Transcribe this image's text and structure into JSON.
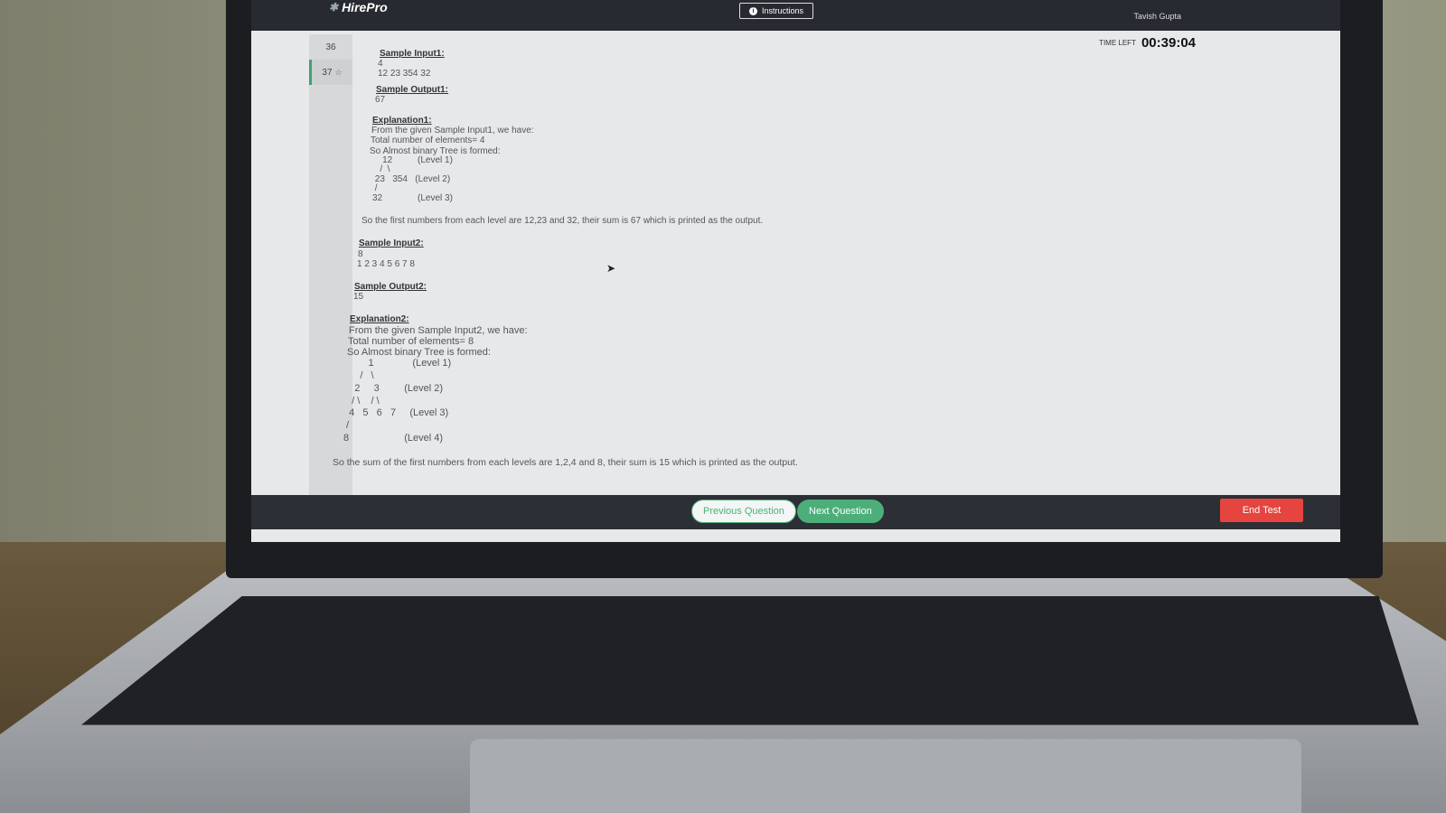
{
  "app": {
    "logo": "HirePro",
    "instructions_label": "Instructions",
    "user_name": "Tavish Gupta",
    "timer_label": "TIME LEFT",
    "timer_value": "00:39:04"
  },
  "question_nav": {
    "items": [
      {
        "number": "36",
        "starred": false,
        "active": false
      },
      {
        "number": "37",
        "starred": true,
        "active": true
      }
    ]
  },
  "content": {
    "sample_input1_title": "Sample Input1:",
    "sample_input1_line1": "4",
    "sample_input1_line2": "12 23 354 32",
    "sample_output1_title": "Sample Output1:",
    "sample_output1_value": "67",
    "explanation1_title": "Explanation1:",
    "explanation1_lines": [
      "From the given Sample Input1, we have:",
      "Total number of elements= 4",
      "So Almost binary Tree is formed:"
    ],
    "tree1": "    12          (Level 1)\n   /  \\\n 23   354   (Level 2)\n /\n32              (Level 3)",
    "explanation1_summary": "So the first numbers from each level are 12,23 and 32, their sum is 67 which is printed as the output.",
    "sample_input2_title": "Sample Input2:",
    "sample_input2_line1": "8",
    "sample_input2_line2": "1 2 3 4 5 6 7 8",
    "sample_output2_title": "Sample Output2:",
    "sample_output2_value": "15",
    "explanation2_title": "Explanation2:",
    "explanation2_lines": [
      "From the given Sample Input2, we have:",
      "Total number of elements= 8",
      "So Almost binary Tree is formed:"
    ],
    "tree2": "         1              (Level 1)\n      /   \\\n    2     3         (Level 2)\n   / \\    / \\\n  4   5   6   7     (Level 3)\n /\n8                    (Level 4)",
    "explanation2_summary": "So the sum of the first numbers from each levels are 1,2,4 and 8, their sum is 15 which is printed as the output."
  },
  "footer": {
    "previous_label": "Previous Question",
    "next_label": "Next Question",
    "end_label": "End Test"
  },
  "colors": {
    "accent_green": "#4caf7a",
    "end_red": "#e5443f",
    "topbar": "#272a30"
  }
}
